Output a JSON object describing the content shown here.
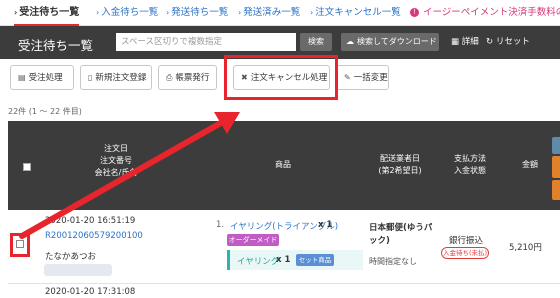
{
  "tabs": [
    {
      "label": "受注待ち一覧",
      "active": true
    },
    {
      "label": "入金待ち一覧"
    },
    {
      "label": "発送待ち一覧"
    },
    {
      "label": "発送済み一覧"
    },
    {
      "label": "注文キャンセル一覧"
    },
    {
      "label": "イージーペイメント決済手数料の減"
    }
  ],
  "header": {
    "title": "受注待ち一覧",
    "search_placeholder": "スペース区切りで複数指定",
    "search_button": "検索",
    "download_button": "検索してダウンロード",
    "detail_link": "詳細",
    "reset_link": "リセット"
  },
  "actions": [
    {
      "label": "受注処理",
      "icon": "list-icon"
    },
    {
      "label": "新規注文登録",
      "icon": "document-icon"
    },
    {
      "label": "帳票発行",
      "icon": "print-icon"
    },
    {
      "label": "注文キャンセル処理",
      "icon": "x-icon"
    },
    {
      "label": "一括変更",
      "icon": "pencil-icon"
    }
  ],
  "count_text": "22件 (1 〜 22 件目)",
  "table": {
    "headers": {
      "order": [
        "注文日",
        "注文番号",
        "会社名/氏名"
      ],
      "item": "商品",
      "delivery": [
        "配送業者日",
        "(第2希望日)"
      ],
      "payment": [
        "支払方法",
        "入金状態"
      ],
      "amount": "金額"
    },
    "rows": [
      {
        "date": "2020-01-20 16:51:19",
        "order_no": "R20012060579200100",
        "name": "たなかあつお",
        "item_index": "1.",
        "item_name": "イヤリング(トライアングル)",
        "item_qty": "x 1",
        "item_tag": "オーダーメイド",
        "set_name": "イヤリング",
        "set_qty": "x 1",
        "set_tag": "セット商品",
        "delivery": "日本郵便(ゆうパック)",
        "delivery_note": "時間指定なし",
        "payment": "銀行振込",
        "payment_status": "入金待ち(未払)",
        "amount": "5,210円"
      },
      {
        "date": "2020-01-20 17:31:08"
      }
    ]
  },
  "colors": {
    "header_bg": "#3c3c3c",
    "accent_red": "#e8242c",
    "link_blue": "#2a73c8",
    "tag_purple": "#c05cc4",
    "set_teal": "#29b7a7"
  }
}
